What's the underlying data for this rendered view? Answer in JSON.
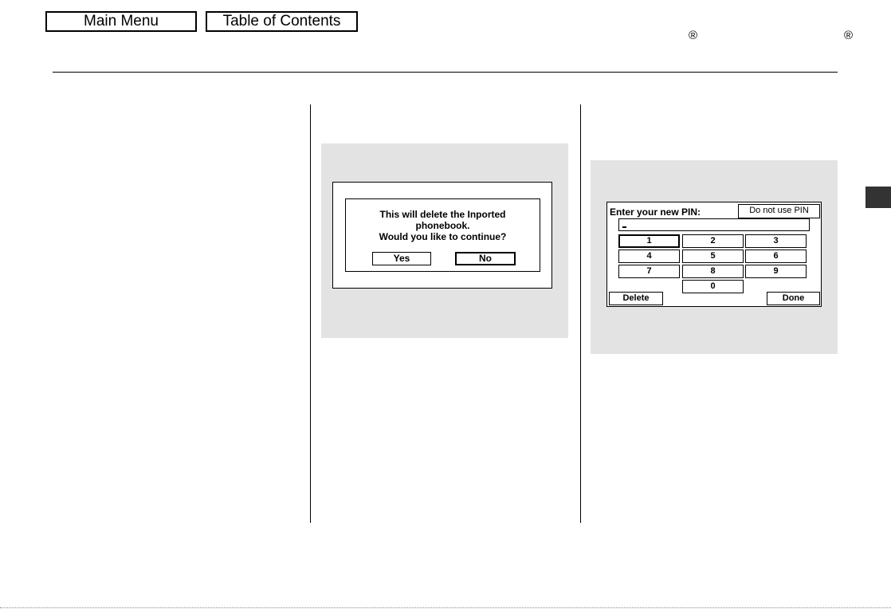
{
  "nav": {
    "main_menu": "Main Menu",
    "table_of_contents": "Table of Contents",
    "registered_mark": "®"
  },
  "dialog": {
    "line1": "This will delete the Inported",
    "line2": "phonebook.",
    "line3": "Would you like to continue?",
    "yes": "Yes",
    "no": "No"
  },
  "pin_screen": {
    "label": "Enter your new PIN:",
    "do_not_use": "Do not use PIN",
    "entry_value": "",
    "keys": [
      "1",
      "2",
      "3",
      "4",
      "5",
      "6",
      "7",
      "8",
      "9",
      "0"
    ],
    "selected_key": "1",
    "delete": "Delete",
    "done": "Done"
  },
  "colors": {
    "panel_gray": "#e3e3e3",
    "section_tab": "#333333"
  }
}
